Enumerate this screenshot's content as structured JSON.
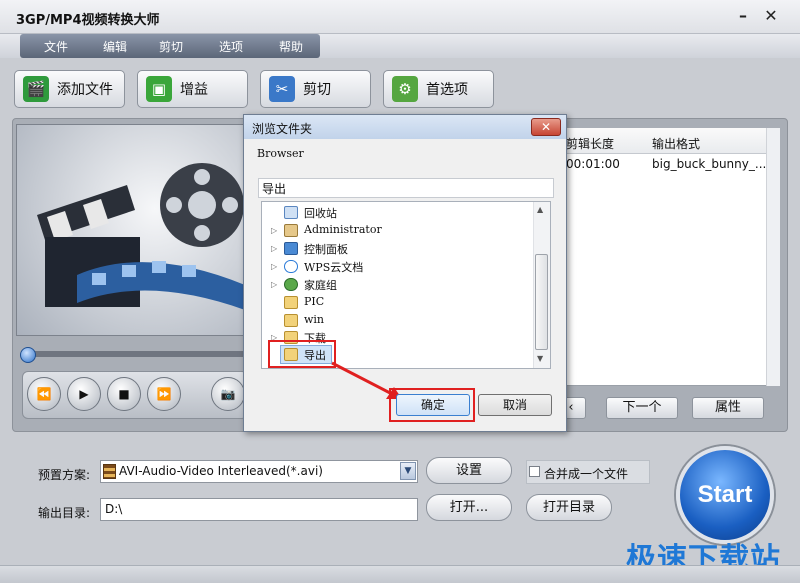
{
  "window": {
    "title": "3GP/MP4视频转换大师",
    "min_glyph": "–",
    "close_glyph": "✕"
  },
  "menu": [
    "文件",
    "编辑",
    "剪切",
    "选项",
    "帮助"
  ],
  "toolbar": [
    {
      "label": "添加文件",
      "icon": "add-file-icon",
      "color": "#2f9a3c"
    },
    {
      "label": "增益",
      "icon": "gain-icon",
      "color": "#3aa63a"
    },
    {
      "label": "剪切",
      "icon": "cut-icon",
      "color": "#3a78c8"
    },
    {
      "label": "首选项",
      "icon": "preferences-icon",
      "color": "#55a640"
    }
  ],
  "file_list": {
    "headers": [
      "剪辑长度",
      "输出格式"
    ],
    "rows": [
      {
        "length": "00:01:00",
        "format": "big_buck_bunny_..."
      }
    ]
  },
  "nav": {
    "next": "下一个",
    "properties": "属性"
  },
  "player": {
    "rewind": "⏪",
    "play": "▶",
    "stop": "■",
    "forward": "⏩",
    "snapshot": "📷"
  },
  "preset": {
    "label": "预置方案:",
    "value": "AVI-Audio-Video Interleaved(*.avi)",
    "settings": "设置",
    "merge": "合并成一个文件"
  },
  "output": {
    "label": "输出目录:",
    "value": "D:\\",
    "open": "打开...",
    "open_dir": "打开目录"
  },
  "start": "Start",
  "watermark": "极速下载站",
  "dialog": {
    "title": "浏览文件夹",
    "close": "✕",
    "subtitle": "Browser",
    "path": "导出",
    "tree": [
      "回收站",
      "Administrator",
      "控制面板",
      "WPS云文档",
      "家庭组",
      "PIC",
      "win",
      "下载",
      "导出"
    ],
    "ok": "确定",
    "cancel": "取消"
  },
  "colors": {
    "accent": "#1f78d6",
    "highlight": "#e02020",
    "start": "#1a5fc2"
  }
}
